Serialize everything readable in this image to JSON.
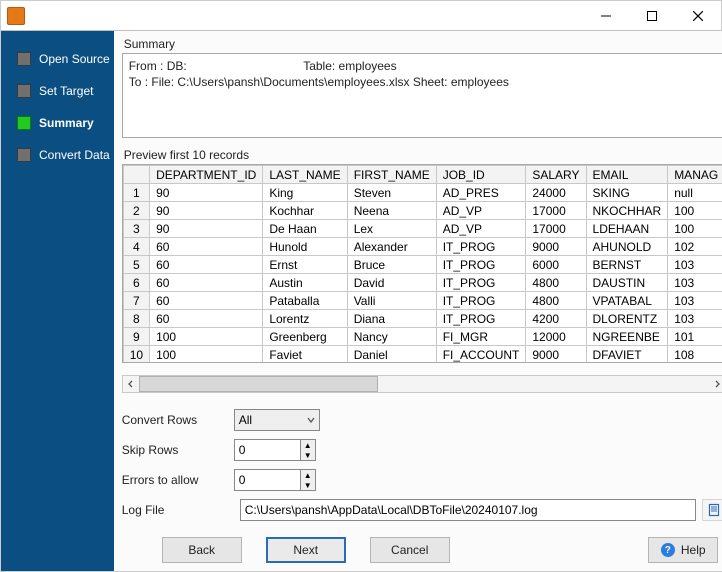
{
  "titlebar": {
    "title": ""
  },
  "sidebar": {
    "steps": [
      {
        "label": "Open Source",
        "active": false
      },
      {
        "label": "Set Target",
        "active": false
      },
      {
        "label": "Summary",
        "active": true
      },
      {
        "label": "Convert Data",
        "active": false
      }
    ]
  },
  "summary": {
    "header": "Summary",
    "from_label": "From : DB:",
    "from_table_label": "Table: employees",
    "to_line": "To : File: C:\\Users\\pansh\\Documents\\employees.xlsx Sheet: employees"
  },
  "preview": {
    "header": "Preview first 10 records",
    "columns": [
      "DEPARTMENT_ID",
      "LAST_NAME",
      "FIRST_NAME",
      "JOB_ID",
      "SALARY",
      "EMAIL",
      "MANAG"
    ],
    "rows": [
      [
        "90",
        "King",
        "Steven",
        "AD_PRES",
        "24000",
        "SKING",
        "null"
      ],
      [
        "90",
        "Kochhar",
        "Neena",
        "AD_VP",
        "17000",
        "NKOCHHAR",
        "100"
      ],
      [
        "90",
        "De Haan",
        "Lex",
        "AD_VP",
        "17000",
        "LDEHAAN",
        "100"
      ],
      [
        "60",
        "Hunold",
        "Alexander",
        "IT_PROG",
        "9000",
        "AHUNOLD",
        "102"
      ],
      [
        "60",
        "Ernst",
        "Bruce",
        "IT_PROG",
        "6000",
        "BERNST",
        "103"
      ],
      [
        "60",
        "Austin",
        "David",
        "IT_PROG",
        "4800",
        "DAUSTIN",
        "103"
      ],
      [
        "60",
        "Pataballa",
        "Valli",
        "IT_PROG",
        "4800",
        "VPATABAL",
        "103"
      ],
      [
        "60",
        "Lorentz",
        "Diana",
        "IT_PROG",
        "4200",
        "DLORENTZ",
        "103"
      ],
      [
        "100",
        "Greenberg",
        "Nancy",
        "FI_MGR",
        "12000",
        "NGREENBE",
        "101"
      ],
      [
        "100",
        "Faviet",
        "Daniel",
        "FI_ACCOUNT",
        "9000",
        "DFAVIET",
        "108"
      ]
    ]
  },
  "form": {
    "convert_rows_label": "Convert Rows",
    "convert_rows_value": "All",
    "skip_rows_label": "Skip Rows",
    "skip_rows_value": "0",
    "errors_label": "Errors to allow",
    "errors_value": "0",
    "logfile_label": "Log File",
    "logfile_value": "C:\\Users\\pansh\\AppData\\Local\\DBToFile\\20240107.log"
  },
  "buttons": {
    "back": "Back",
    "next": "Next",
    "cancel": "Cancel",
    "help": "Help"
  }
}
